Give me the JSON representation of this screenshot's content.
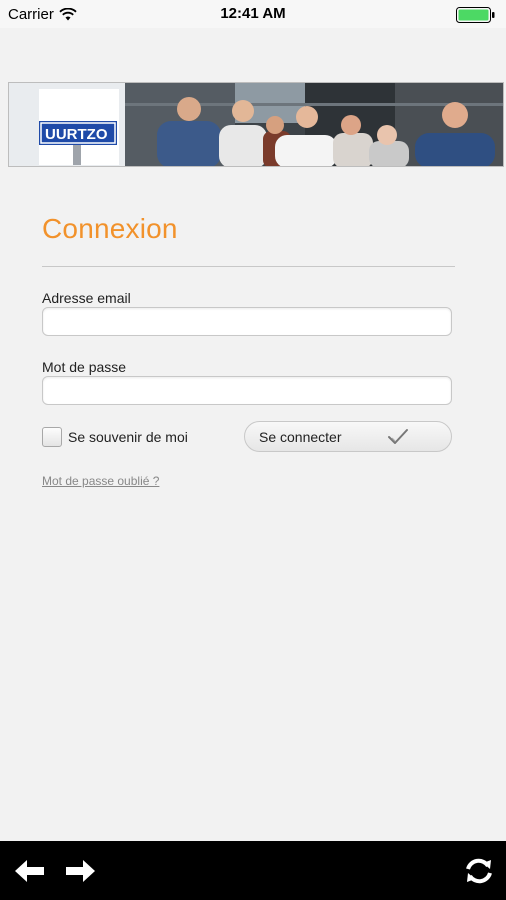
{
  "status": {
    "carrier": "Carrier",
    "time": "12:41 AM"
  },
  "banner": {
    "sign_text": "UURTZO"
  },
  "login": {
    "title": "Connexion",
    "email_label": "Adresse email",
    "email_value": "",
    "password_label": "Mot de passe",
    "password_value": "",
    "remember_label": "Se souvenir de moi",
    "remember_checked": false,
    "connect_label": "Se connecter",
    "forgot_label": "Mot de passe oublié ?"
  },
  "colors": {
    "accent": "#f2922b",
    "battery": "#4cd964"
  },
  "icons": {
    "back": "arrow-left-icon",
    "forward": "arrow-right-icon",
    "refresh": "refresh-icon"
  }
}
